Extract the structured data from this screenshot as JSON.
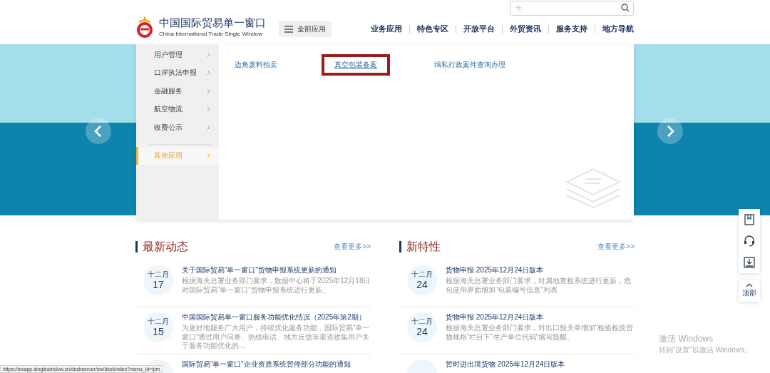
{
  "header": {
    "logo_title": "中国国际贸易单一窗口",
    "logo_subtitle": "China International Trade Single Window",
    "search": {
      "placeholder": "卡"
    },
    "all_apps_button": "全部应用",
    "nav": [
      "业务应用",
      "特色专区",
      "开放平台",
      "外贸资讯",
      "服务支持",
      "地方导航"
    ]
  },
  "menu": {
    "category_groups": [
      [
        {
          "label": "用户管理",
          "selected": false
        },
        {
          "label": "口岸执法申报",
          "selected": false
        },
        {
          "label": "金融服务",
          "selected": false
        },
        {
          "label": "航空物流",
          "selected": false
        },
        {
          "label": "收费公示",
          "selected": false
        }
      ],
      [
        {
          "label": "其他应用",
          "selected": true
        }
      ]
    ],
    "links": [
      {
        "label": "边角废料拍卖",
        "highlighted": false
      },
      {
        "label": "真空包装备案",
        "highlighted": true
      },
      {
        "label": "缉私行政案件查询办理",
        "highlighted": false
      }
    ]
  },
  "sections": [
    {
      "title": "最新动态",
      "more": "查看更多>>",
      "items": [
        {
          "month": "十二月",
          "day": "17",
          "title": "关于国际贸易“单一窗口”货物申报系统更新的通知",
          "summary": "根据海关总署业务部门要求，数据中心将于2025年12月18日对国际贸易“单一窗口”货物申报系统进行更新。"
        },
        {
          "month": "十二月",
          "day": "15",
          "title": "中国国际贸易单一窗口服务功能优化情况（2025年第2期）",
          "summary": "为更好地服务广大用户，持续优化服务功能，国际贸易“单一窗口”通过用户问卷、热线电话、地方反馈等渠道收集用户关于服务功能优化的..."
        },
        {
          "title": "国际贸易“单一窗口”企业资质系统暂停部分功能的通知"
        }
      ]
    },
    {
      "title": "新特性",
      "more": "查看更多>>",
      "items": [
        {
          "month": "十二月",
          "day": "24",
          "title": "货物申报 2025年12月24日版本",
          "summary": "根据海关总署业务部门要求，对属地查检系统进行更新，危包使用界面增加“包装编号信息”列表"
        },
        {
          "month": "十二月",
          "day": "24",
          "title": "货物申报 2025年12月24日版本",
          "summary": "根据海关总署业务部门要求，对出口报关单增加“检验检疫货物规格”栏目下“生产单位代码”填写提醒。"
        },
        {
          "title": "暂时进出境货物 2025年12月24日版本"
        }
      ]
    }
  ],
  "side_tools": {
    "top_label": "顶部"
  },
  "os_notice": {
    "title": "激活 Windows",
    "text": "转到“设置”以激活 Windows。"
  },
  "status_bar": {
    "url": "https://swapp.singlewindow.cn/deskserver/sw/deskIndex?menu_id=ipm"
  }
}
